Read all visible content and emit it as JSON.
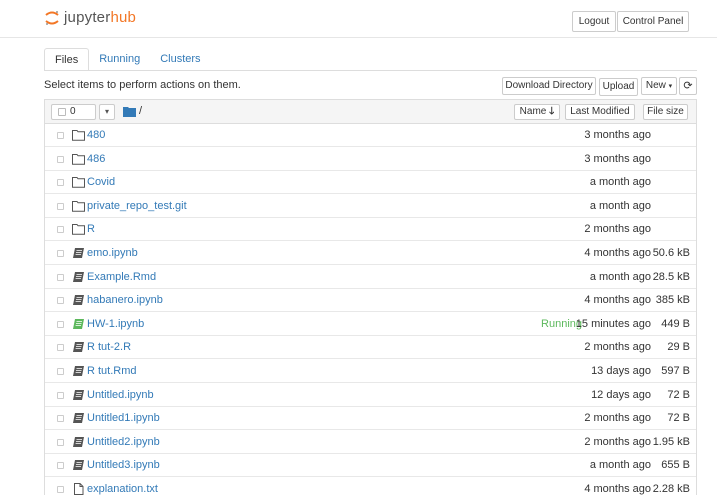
{
  "header": {
    "logo_prefix": "jupyter",
    "logo_suffix": "hub",
    "logout_label": "Logout",
    "control_panel_label": "Control Panel",
    "brand_color": "#f37726"
  },
  "tabs": [
    {
      "label": "Files",
      "active": true
    },
    {
      "label": "Running",
      "active": false
    },
    {
      "label": "Clusters",
      "active": false
    }
  ],
  "toolbar": {
    "hint": "Select items to perform actions on them.",
    "download_label": "Download Directory",
    "upload_label": "Upload",
    "new_label": "New",
    "refresh_icon": "refresh-icon"
  },
  "list_header": {
    "selected_count": "0",
    "path": "/",
    "name_label": "Name",
    "name_sort_icon": "arrow-down-icon",
    "modified_label": "Last Modified",
    "size_label": "File size"
  },
  "files": [
    {
      "name": "480",
      "type": "folder",
      "modified": "3 months ago",
      "size": "",
      "status": ""
    },
    {
      "name": "486",
      "type": "folder",
      "modified": "3 months ago",
      "size": "",
      "status": ""
    },
    {
      "name": "Covid",
      "type": "folder",
      "modified": "a month ago",
      "size": "",
      "status": ""
    },
    {
      "name": "private_repo_test.git",
      "type": "folder",
      "modified": "a month ago",
      "size": "",
      "status": ""
    },
    {
      "name": "R",
      "type": "folder",
      "modified": "2 months ago",
      "size": "",
      "status": ""
    },
    {
      "name": "emo.ipynb",
      "type": "notebook",
      "modified": "4 months ago",
      "size": "50.6 kB",
      "status": ""
    },
    {
      "name": "Example.Rmd",
      "type": "notebook",
      "modified": "a month ago",
      "size": "28.5 kB",
      "status": ""
    },
    {
      "name": "habanero.ipynb",
      "type": "notebook",
      "modified": "4 months ago",
      "size": "385 kB",
      "status": ""
    },
    {
      "name": "HW-1.ipynb",
      "type": "notebook-running",
      "modified": "15 minutes ago",
      "size": "449 B",
      "status": "Running"
    },
    {
      "name": "R tut-2.R",
      "type": "notebook",
      "modified": "2 months ago",
      "size": "29 B",
      "status": ""
    },
    {
      "name": "R tut.Rmd",
      "type": "notebook",
      "modified": "13 days ago",
      "size": "597 B",
      "status": ""
    },
    {
      "name": "Untitled.ipynb",
      "type": "notebook",
      "modified": "12 days ago",
      "size": "72 B",
      "status": ""
    },
    {
      "name": "Untitled1.ipynb",
      "type": "notebook",
      "modified": "2 months ago",
      "size": "72 B",
      "status": ""
    },
    {
      "name": "Untitled2.ipynb",
      "type": "notebook",
      "modified": "2 months ago",
      "size": "1.95 kB",
      "status": ""
    },
    {
      "name": "Untitled3.ipynb",
      "type": "notebook",
      "modified": "a month ago",
      "size": "655 B",
      "status": ""
    },
    {
      "name": "explanation.txt",
      "type": "file",
      "modified": "4 months ago",
      "size": "2.28 kB",
      "status": ""
    }
  ],
  "colors": {
    "link": "#337ab7",
    "running": "#5cb85c",
    "folder_icon": "#337ab7"
  }
}
